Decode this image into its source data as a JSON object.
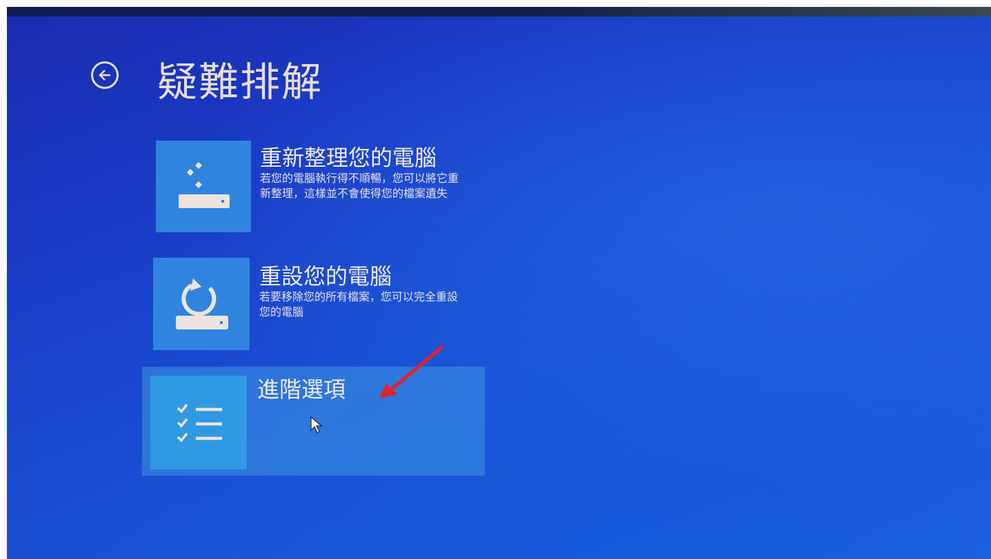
{
  "header": {
    "title": "疑難排解",
    "back_icon": "back-arrow-circle-icon"
  },
  "options": [
    {
      "title": "重新整理您的電腦",
      "description": "若您的電腦執行得不順暢，您可以將它重新整理，這樣並不會使得您的檔案遺失",
      "icon": "refresh-pc-icon"
    },
    {
      "title": "重設您的電腦",
      "description": "若要移除您的所有檔案，您可以完全重設您的電腦",
      "icon": "reset-pc-icon"
    },
    {
      "title": "進階選項",
      "description": "",
      "icon": "advanced-options-checklist-icon",
      "selected": true
    }
  ],
  "colors": {
    "background": "#1a3cc8",
    "tile": "#2f84df",
    "selected_highlight": "#3c96e1",
    "text": "#efe7e3",
    "annotation_arrow": "#e8202a"
  }
}
